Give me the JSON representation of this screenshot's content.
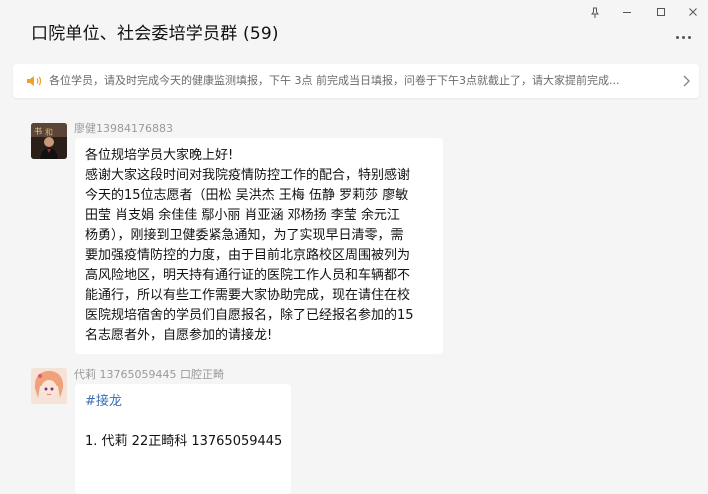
{
  "window": {
    "title": "口院单位、社会委培学员群 (59)",
    "controls": [
      "pin",
      "minimize",
      "maximize",
      "close"
    ]
  },
  "announcement": {
    "icon": "speaker-icon",
    "text": "各位学员，请及时完成今天的健康监测填报，下午 3点 前完成当日填报，问卷于下午3点就截止了，请大家提前完成..."
  },
  "messages": [
    {
      "sender": "廖健13984176883",
      "avatar": "avatar-photo",
      "lines": [
        "各位规培学员大家晚上好!",
        "感谢大家这段时间对我院疫情防控工作的配合，特别感谢",
        "今天的15位志愿者（田松 吴洪杰 王梅 伍静 罗莉莎 廖敏",
        "田莹 肖支娟 余佳佳 鄢小丽 肖亚涵 邓杨扬  李莹 余元江",
        "杨勇），刚接到卫健委紧急通知，为了实现早日清零，需",
        "要加强疫情防控的力度，由于目前北京路校区周围被列为",
        "高风险地区，明天持有通行证的医院工作人员和车辆都不",
        "能通行，所以有些工作需要大家协助完成，现在请住在校",
        "医院规培宿舍的学员们自愿报名，除了已经报名参加的15",
        "名志愿者外，自愿参加的请接龙!"
      ]
    },
    {
      "sender": "代莉 13765059445 口腔正畸",
      "avatar": "avatar-anime",
      "tag": "#接龙",
      "entry": "1. 代莉 22正畸科 13765059445"
    }
  ]
}
